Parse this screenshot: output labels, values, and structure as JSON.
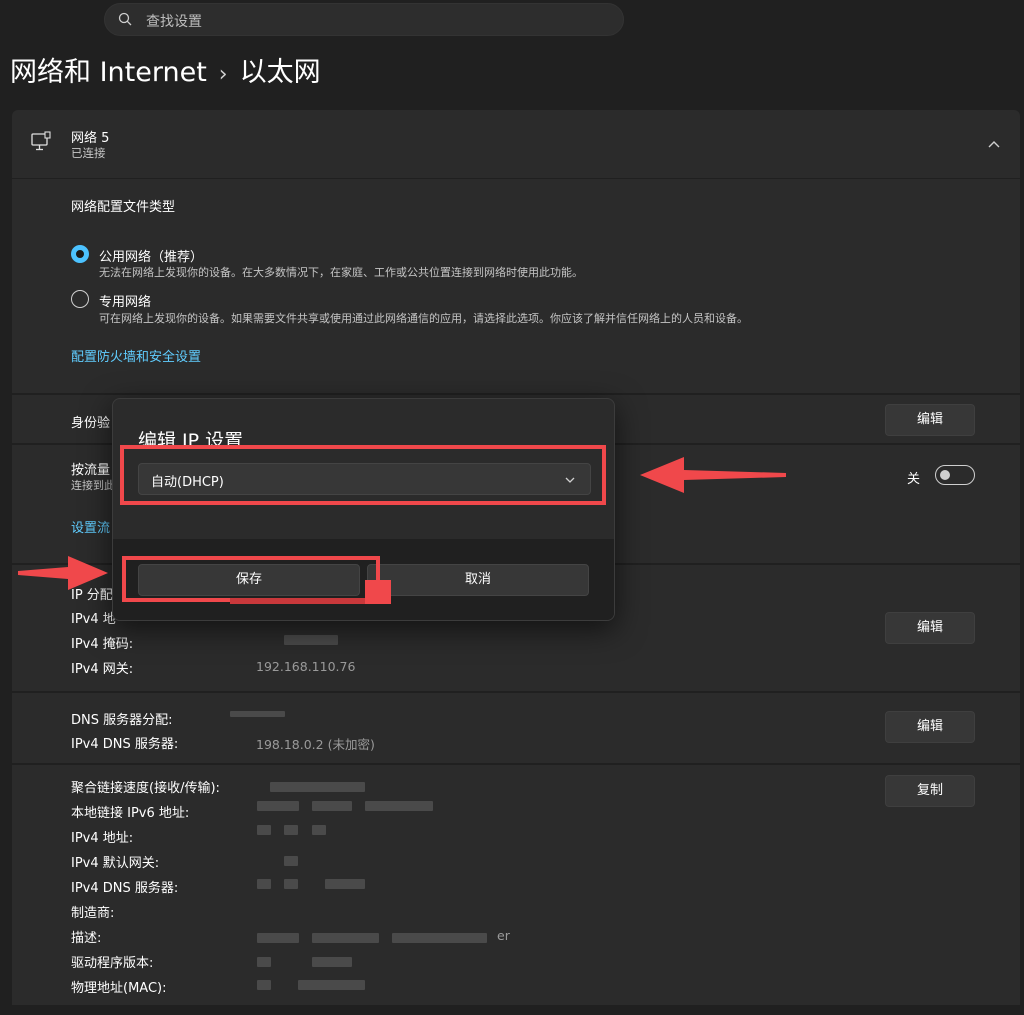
{
  "search": {
    "placeholder": "查找设置",
    "icon": "search-icon"
  },
  "breadcrumb": {
    "parent": "网络和 Internet",
    "separator": "›",
    "current": "以太网"
  },
  "network": {
    "name": "网络 5",
    "status": "已连接"
  },
  "profile": {
    "heading": "网络配置文件类型",
    "options": [
      {
        "label": "公用网络（推荐）",
        "desc": "无法在网络上发现你的设备。在大多数情况下，在家庭、工作或公共位置连接到网络时使用此功能。",
        "selected": true
      },
      {
        "label": "专用网络",
        "desc": "可在网络上发现你的设备。如果需要文件共享或使用通过此网络通信的应用，请选择此选项。你应该了解并信任网络上的人员和设备。",
        "selected": false
      }
    ],
    "firewall_link": "配置防火墙和安全设置"
  },
  "auth": {
    "label": "身份验",
    "edit": "编辑"
  },
  "metered": {
    "label": "按流量",
    "sub": "连接到此",
    "toggle_state": "关",
    "limit_link": "设置流"
  },
  "ip": {
    "assign_label": "IP 分配",
    "ipv4_addr_label": "IPv4 地",
    "mask_label": "IPv4 掩码:",
    "gateway_label": "IPv4 网关:",
    "gateway_value": "192.168.110.76",
    "edit": "编辑"
  },
  "dns": {
    "assign_label": "DNS 服务器分配:",
    "ipv4_label": "IPv4 DNS 服务器:",
    "ipv4_value": "198.18.0.2 (未加密)",
    "edit": "编辑"
  },
  "props": {
    "copy": "复制",
    "labels": [
      "聚合链接速度(接收/传输):",
      "本地链接 IPv6 地址:",
      "IPv4 地址:",
      "IPv4 默认网关:",
      "IPv4 DNS 服务器:",
      "制造商:",
      "描述:",
      "驱动程序版本:",
      "物理地址(MAC):"
    ],
    "desc_tail": "er"
  },
  "dialog": {
    "title": "编辑 IP 设置",
    "dropdown_value": "自动(DHCP)",
    "save": "保存",
    "cancel": "取消"
  },
  "colors": {
    "accent": "#4cc2ff",
    "link": "#60cdff",
    "annotation": "#f0484b"
  }
}
